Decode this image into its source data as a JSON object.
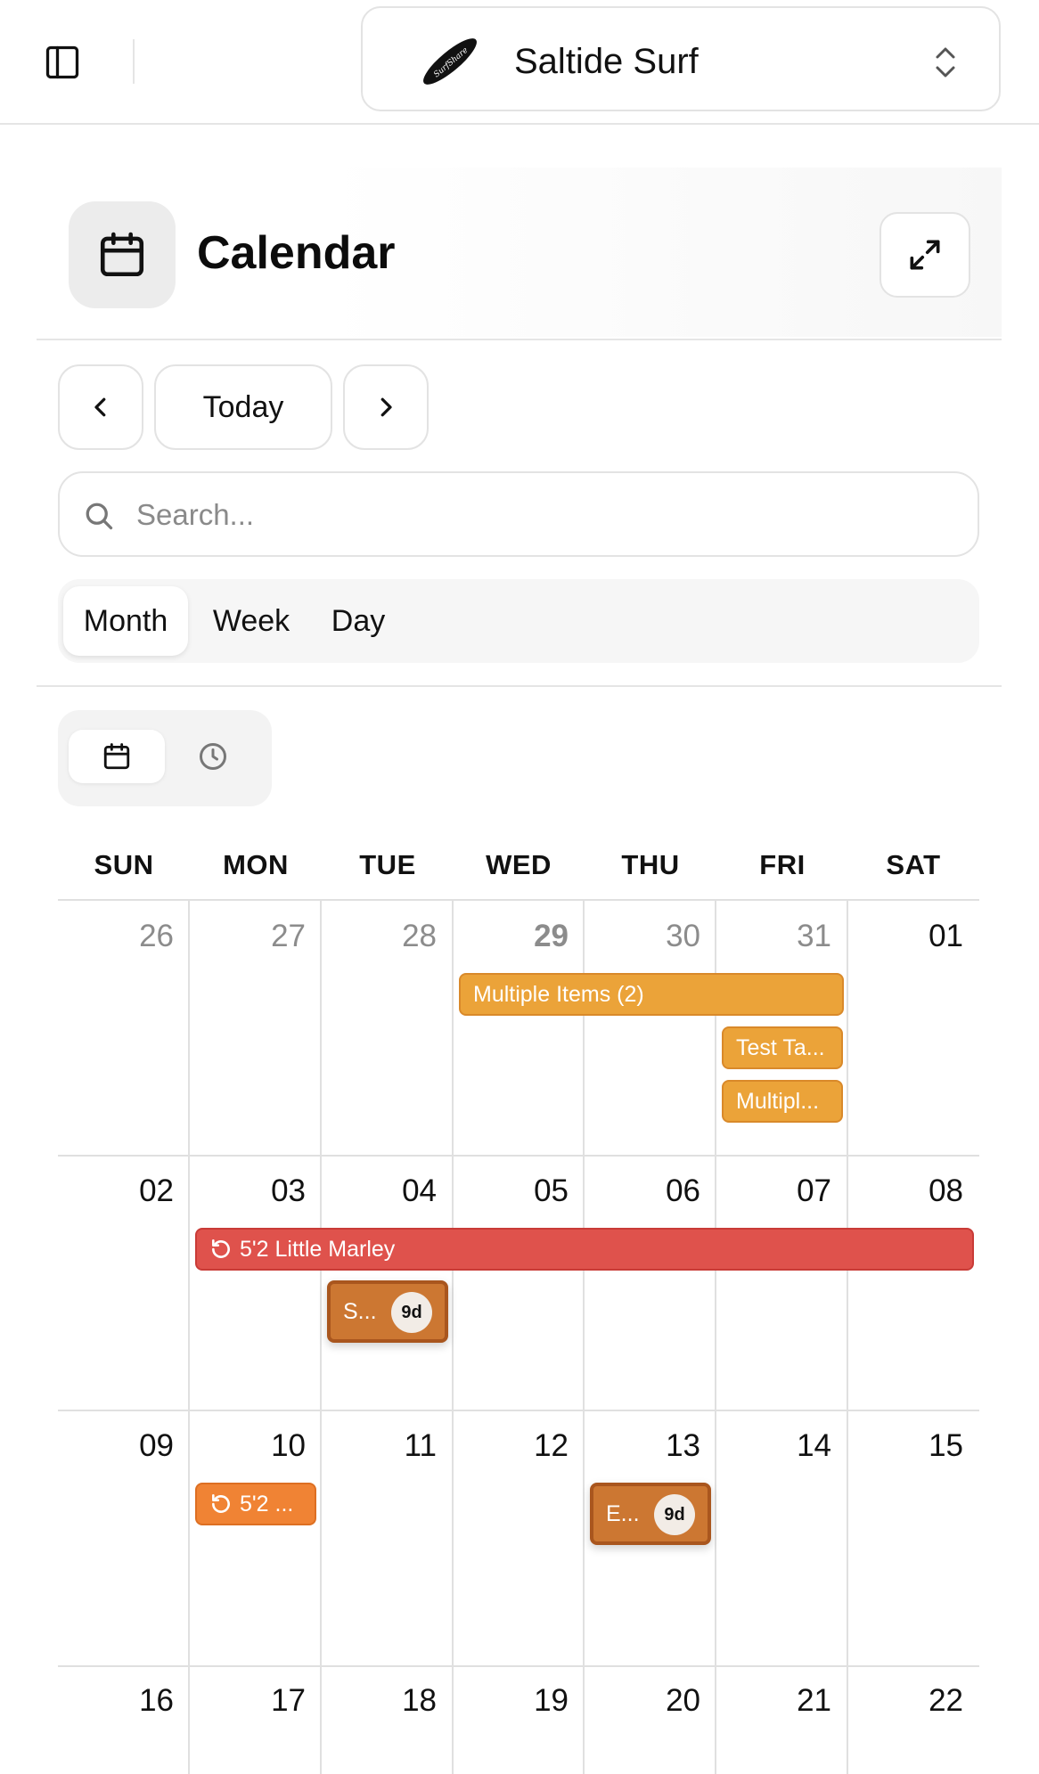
{
  "topbar": {
    "org_name": "Saltide Surf",
    "logo_text": "SurfShare"
  },
  "header": {
    "title": "Calendar"
  },
  "navigation": {
    "today_label": "Today"
  },
  "search": {
    "placeholder": "Search..."
  },
  "view_tabs": [
    {
      "label": "Month",
      "active": true
    },
    {
      "label": "Week",
      "active": false
    },
    {
      "label": "Day",
      "active": false
    }
  ],
  "calendar": {
    "weekdays": [
      "SUN",
      "MON",
      "TUE",
      "WED",
      "THU",
      "FRI",
      "SAT"
    ],
    "weeks": [
      [
        "26",
        "27",
        "28",
        "29",
        "30",
        "31",
        "01"
      ],
      [
        "02",
        "03",
        "04",
        "05",
        "06",
        "07",
        "08"
      ],
      [
        "09",
        "10",
        "11",
        "12",
        "13",
        "14",
        "15"
      ],
      [
        "16",
        "17",
        "18",
        "19",
        "20",
        "21",
        "22"
      ]
    ],
    "events": {
      "multiple_items": "Multiple Items (2)",
      "test_task": "Test Ta...",
      "multiple_short": "Multipl...",
      "little_marley": "5'2 Little Marley",
      "s_item": "S...",
      "s_badge": "9d",
      "little_marley_short": "5'2 ...",
      "e_item": "E...",
      "e_badge": "9d"
    }
  },
  "colors": {
    "amber": "#eba339",
    "red": "#df524c",
    "orange": "#f08334",
    "brown": "#cc7732"
  }
}
